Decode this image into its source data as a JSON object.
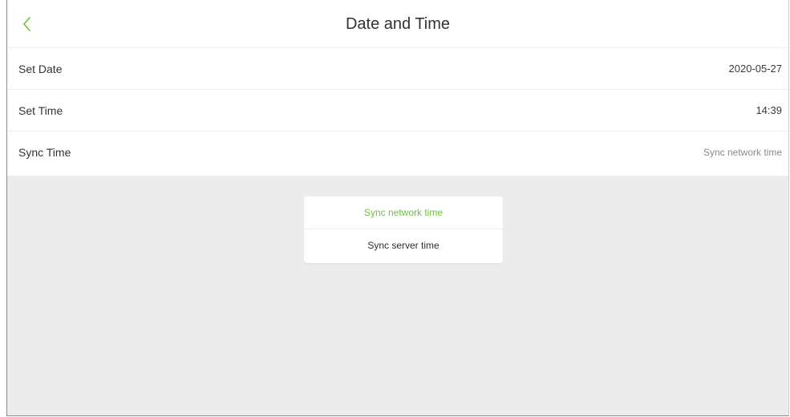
{
  "header": {
    "title": "Date and Time",
    "back_icon": "chevron-left-icon",
    "accent_color": "#6fbe3f"
  },
  "rows": [
    {
      "label": "Set Date",
      "value": "2020-05-27"
    },
    {
      "label": "Set Time",
      "value": "14:39"
    },
    {
      "label": "Sync Time",
      "value": "Sync network time"
    }
  ],
  "popup": {
    "options": [
      {
        "label": "Sync network time",
        "selected": true
      },
      {
        "label": "Sync server time",
        "selected": false
      }
    ]
  }
}
